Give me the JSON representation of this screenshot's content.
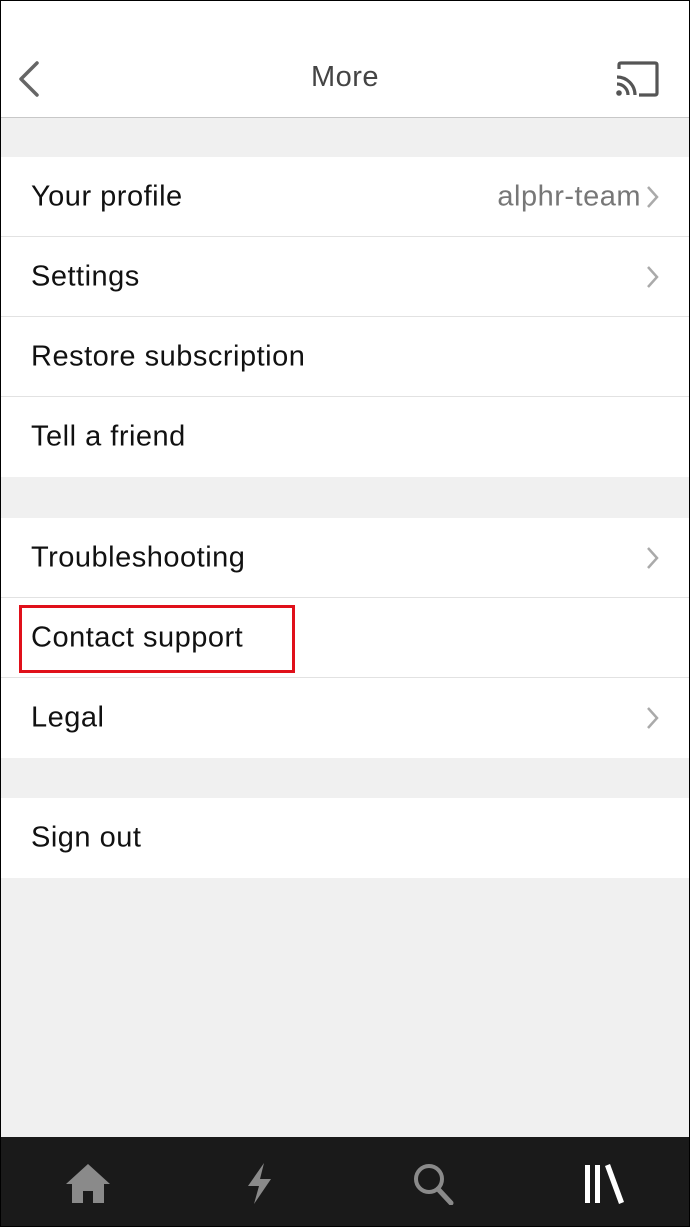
{
  "header": {
    "title": "More"
  },
  "menu": {
    "group1": [
      {
        "label": "Your profile",
        "value": "alphr-team"
      },
      {
        "label": "Settings"
      },
      {
        "label": "Restore subscription"
      },
      {
        "label": "Tell a friend"
      }
    ],
    "group2": [
      {
        "label": "Troubleshooting"
      },
      {
        "label": "Contact support"
      },
      {
        "label": "Legal"
      }
    ],
    "group3": [
      {
        "label": "Sign out"
      }
    ]
  },
  "tabs": [
    {
      "icon": "home-icon"
    },
    {
      "icon": "lightning-icon"
    },
    {
      "icon": "search-icon"
    },
    {
      "icon": "library-icon"
    }
  ],
  "colors": {
    "highlight": "#e0101a",
    "tabbar": "#1a1a1a",
    "background": "#f0f0f0"
  }
}
